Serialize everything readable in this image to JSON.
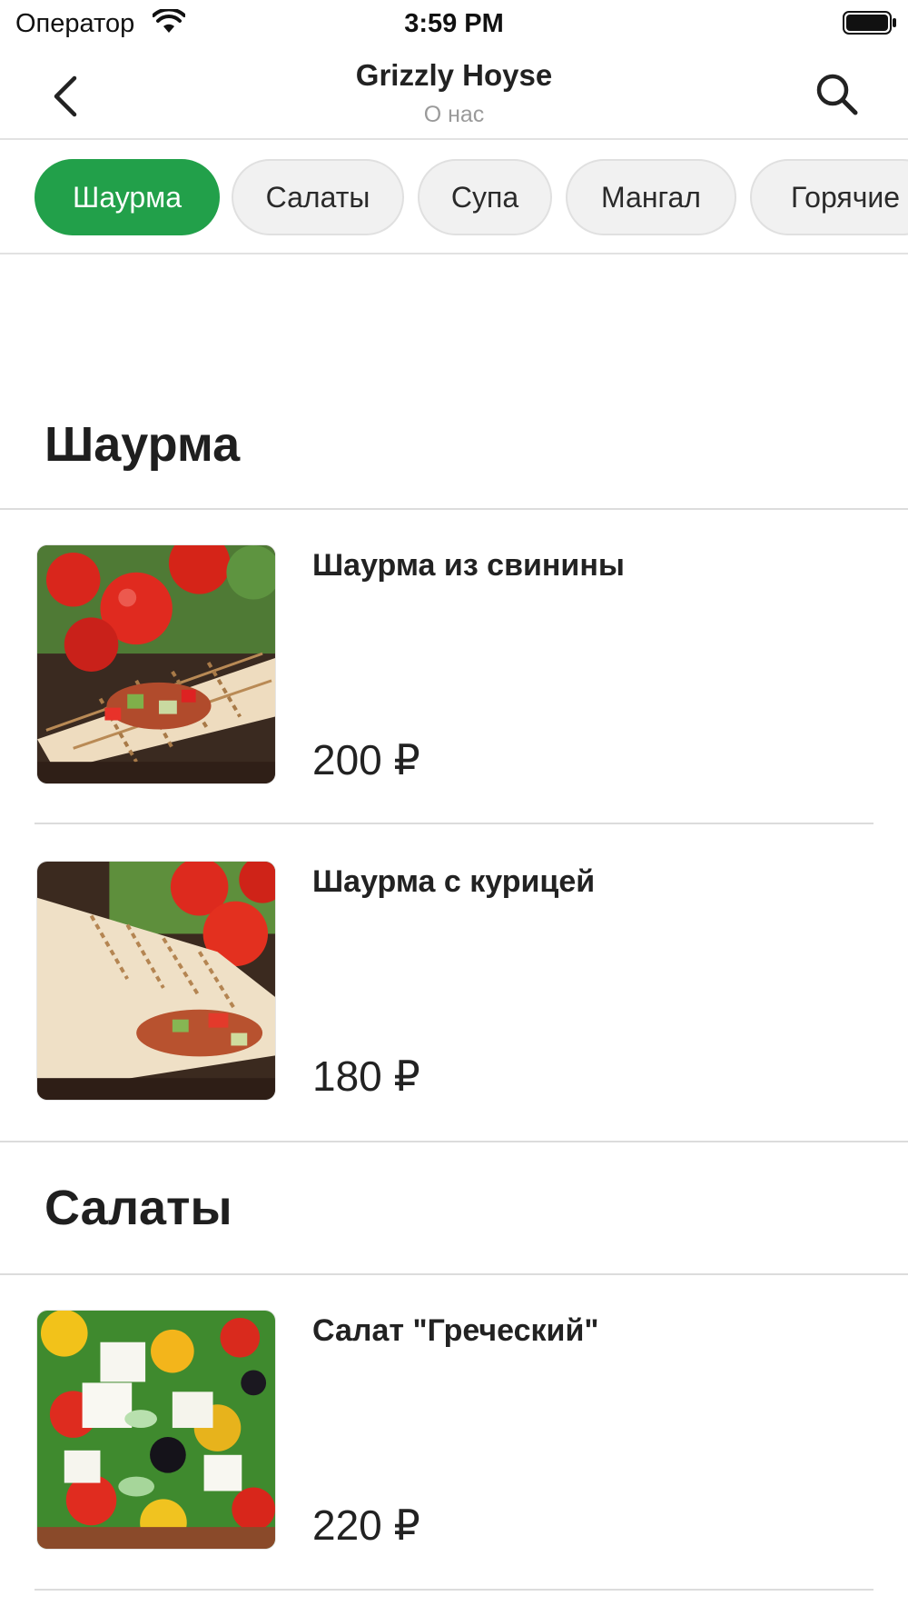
{
  "status_bar": {
    "carrier": "Оператор",
    "time": "3:59 PM"
  },
  "nav": {
    "title": "Grizzly Hoyse",
    "subtitle": "О нас"
  },
  "categories": [
    {
      "label": "Шаурма",
      "active": true
    },
    {
      "label": "Салаты",
      "active": false
    },
    {
      "label": "Супа",
      "active": false
    },
    {
      "label": "Мангал",
      "active": false
    },
    {
      "label": "Горячие",
      "active": false
    }
  ],
  "sections": [
    {
      "title": "Шаурма",
      "items": [
        {
          "name": "Шаурма из свинины",
          "price": "200 ₽",
          "image": "shawarma-pork-photo"
        },
        {
          "name": "Шаурма с курицей",
          "price": "180 ₽",
          "image": "shawarma-chicken-photo"
        }
      ]
    },
    {
      "title": "Салаты",
      "items": [
        {
          "name": "Салат \"Греческий\"",
          "price": "220 ₽",
          "image": "greek-salad-photo"
        }
      ]
    }
  ],
  "colors": {
    "accent": "#22a04a",
    "chip_bg": "#f1f1f1",
    "divider": "#dcdcdc",
    "subtitle": "#9a9a9a"
  }
}
